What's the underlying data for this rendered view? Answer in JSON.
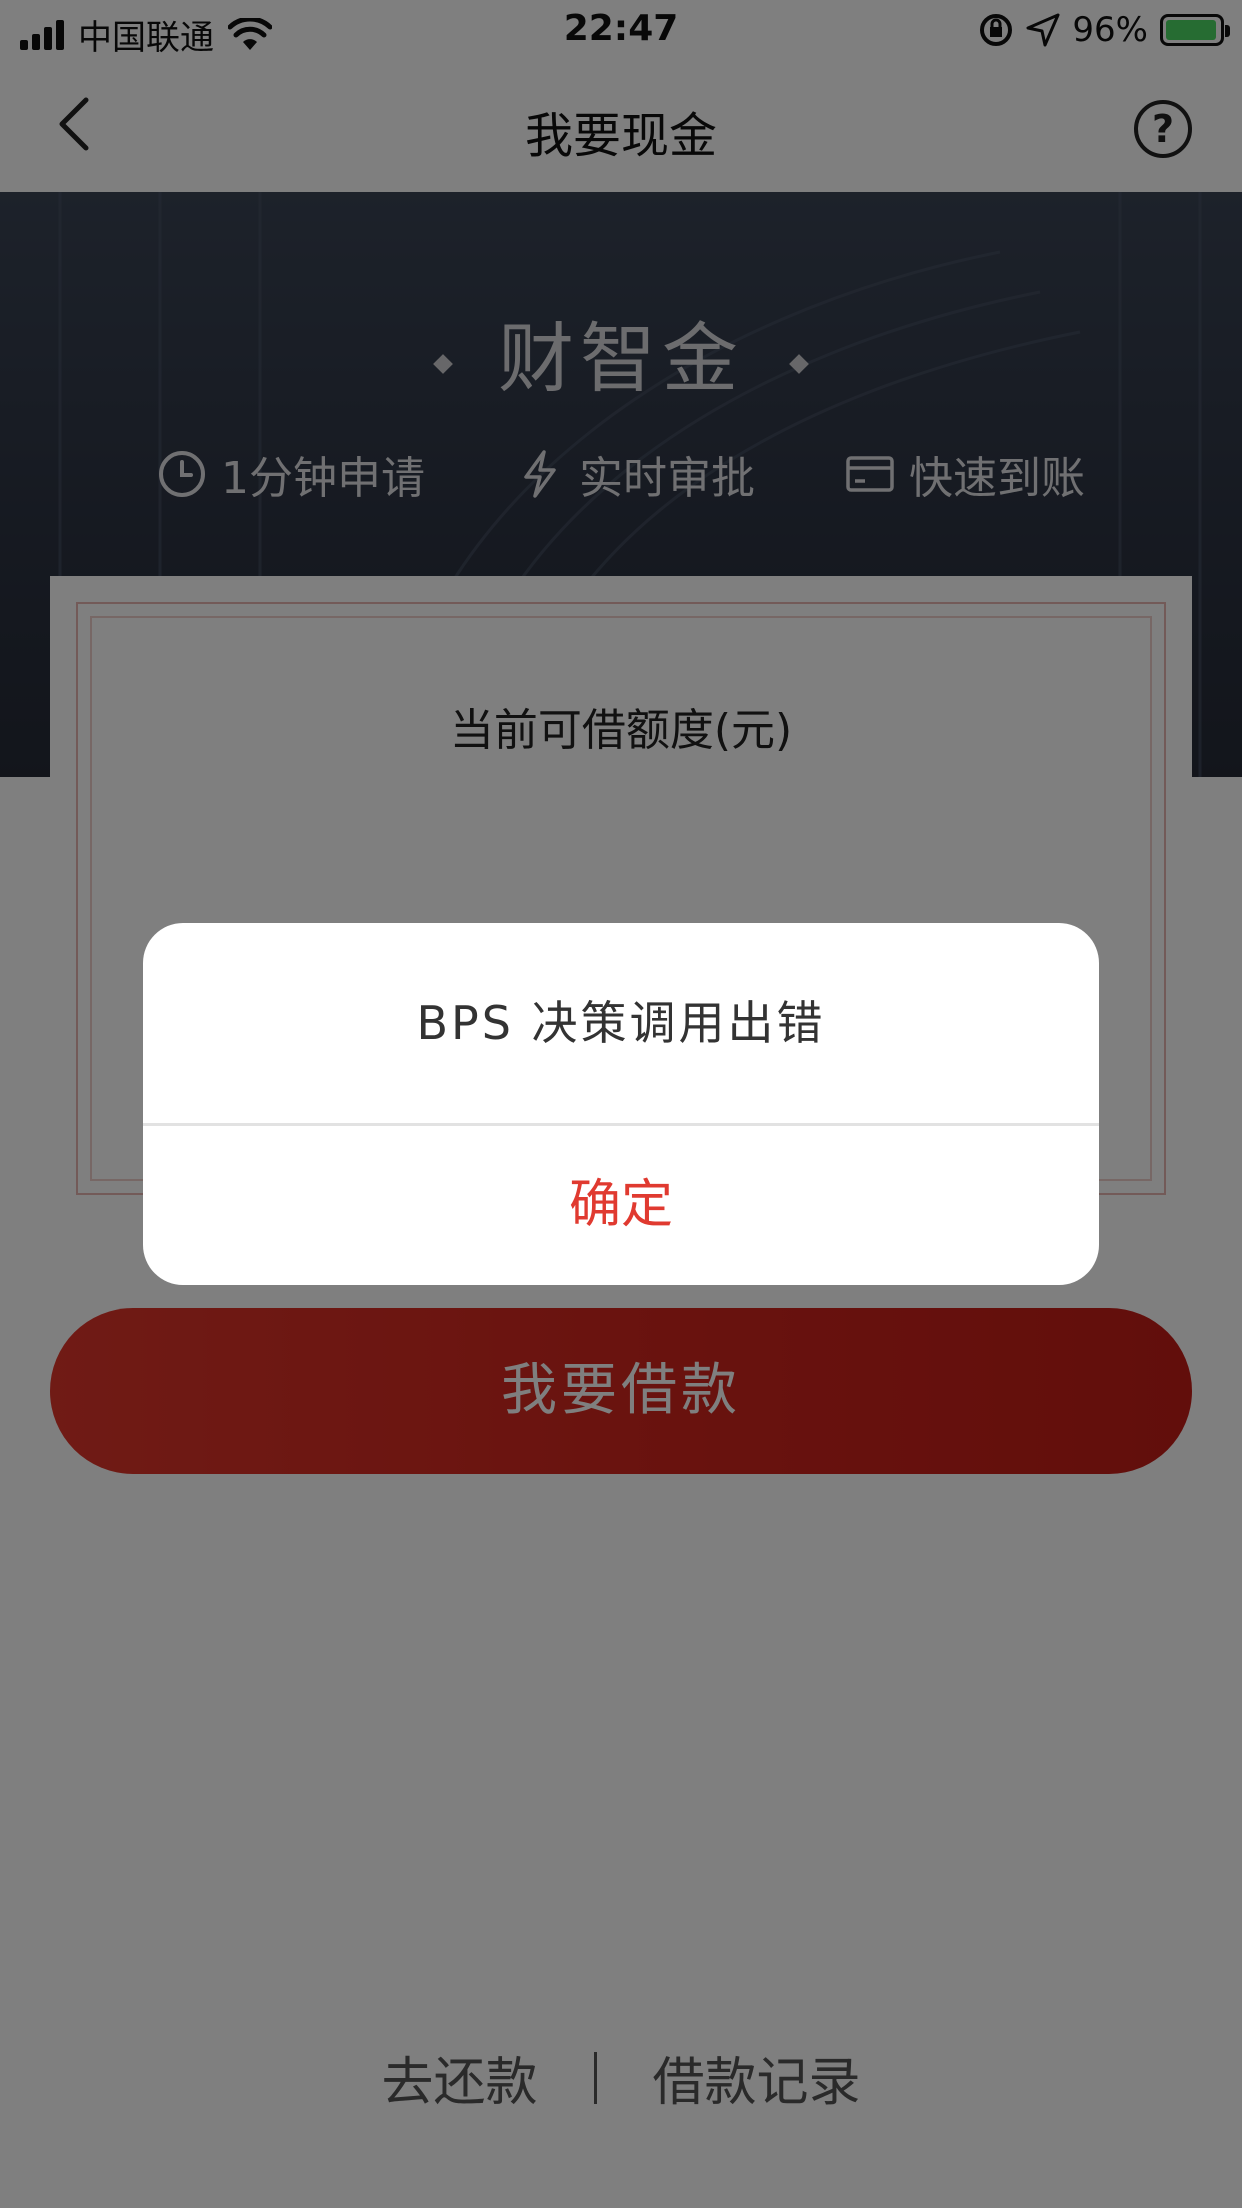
{
  "status_bar": {
    "carrier": "中国联通",
    "time": "22:47",
    "battery": "96%"
  },
  "nav": {
    "title": "我要现金"
  },
  "banner": {
    "brand": "财智金",
    "features": [
      {
        "icon": "clock-icon",
        "label": "1分钟申请"
      },
      {
        "icon": "lightning-icon",
        "label": "实时审批"
      },
      {
        "icon": "card-icon",
        "label": "快速到账"
      }
    ]
  },
  "credit": {
    "label": "当前可借额度(元)",
    "amount": "--"
  },
  "borrow_button": "我要借款",
  "bottom_links": {
    "repay": "去还款",
    "records": "借款记录"
  },
  "alert": {
    "message": "BPS 决策调用出错",
    "confirm": "确定"
  },
  "colors": {
    "accent_red": "#e03a30",
    "banner_dark": "#2c3342",
    "battery_green": "#4cd964"
  }
}
